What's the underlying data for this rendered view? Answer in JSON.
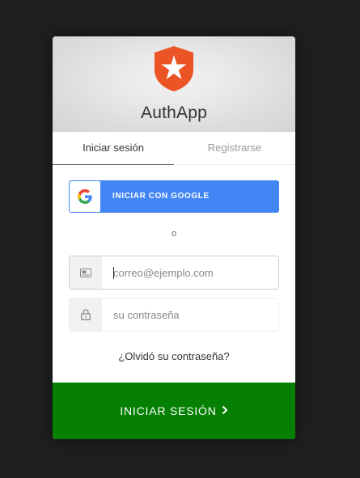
{
  "app": {
    "title": "AuthApp",
    "logo_icon": "shield-star-icon",
    "logo_color": "#eb5424"
  },
  "tabs": [
    {
      "label": "Iniciar sesión",
      "active": true
    },
    {
      "label": "Registrarse",
      "active": false
    }
  ],
  "social": {
    "google_label": "INICIAR CON GOOGLE",
    "google_icon": "google-icon",
    "google_color": "#4285f4"
  },
  "divider": {
    "text": "o"
  },
  "fields": {
    "email": {
      "icon": "email-card-icon",
      "placeholder": "correo@ejemplo.com",
      "value": ""
    },
    "password": {
      "icon": "lock-icon",
      "placeholder": "su contraseña",
      "value": ""
    }
  },
  "forgot": {
    "label": "¿Olvidó su contraseña?"
  },
  "submit": {
    "label": "INICIAR SESIÓN",
    "icon": "chevron-right-icon",
    "color": "#068002"
  }
}
